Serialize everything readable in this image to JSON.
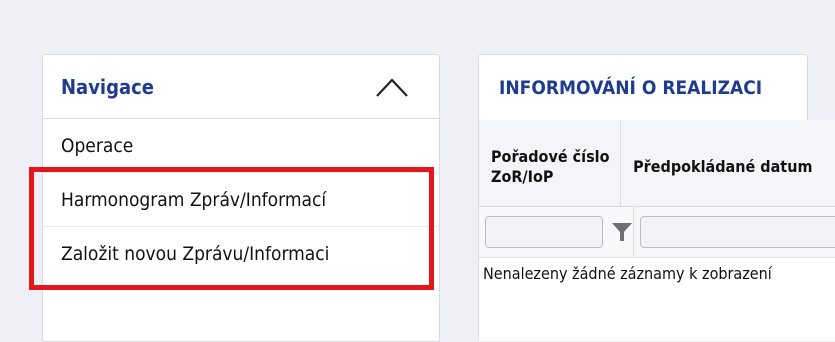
{
  "navigation": {
    "title": "Navigace",
    "items": [
      {
        "label": "Operace"
      },
      {
        "label": "Harmonogram Zpráv/Informací"
      },
      {
        "label": "Založit novou Zprávu/Informaci"
      }
    ]
  },
  "tab": {
    "label": "INFORMOVÁNÍ O REALIZACI"
  },
  "table": {
    "columns": [
      {
        "label": "Pořadové číslo ZoR/IoP"
      },
      {
        "label": "Předpokládané datum"
      }
    ],
    "empty_message": "Nenalezeny žádné záznamy k zobrazení"
  },
  "colors": {
    "accent": "#1f3d8f",
    "highlight": "#e5151c",
    "background": "#eef0f6"
  }
}
